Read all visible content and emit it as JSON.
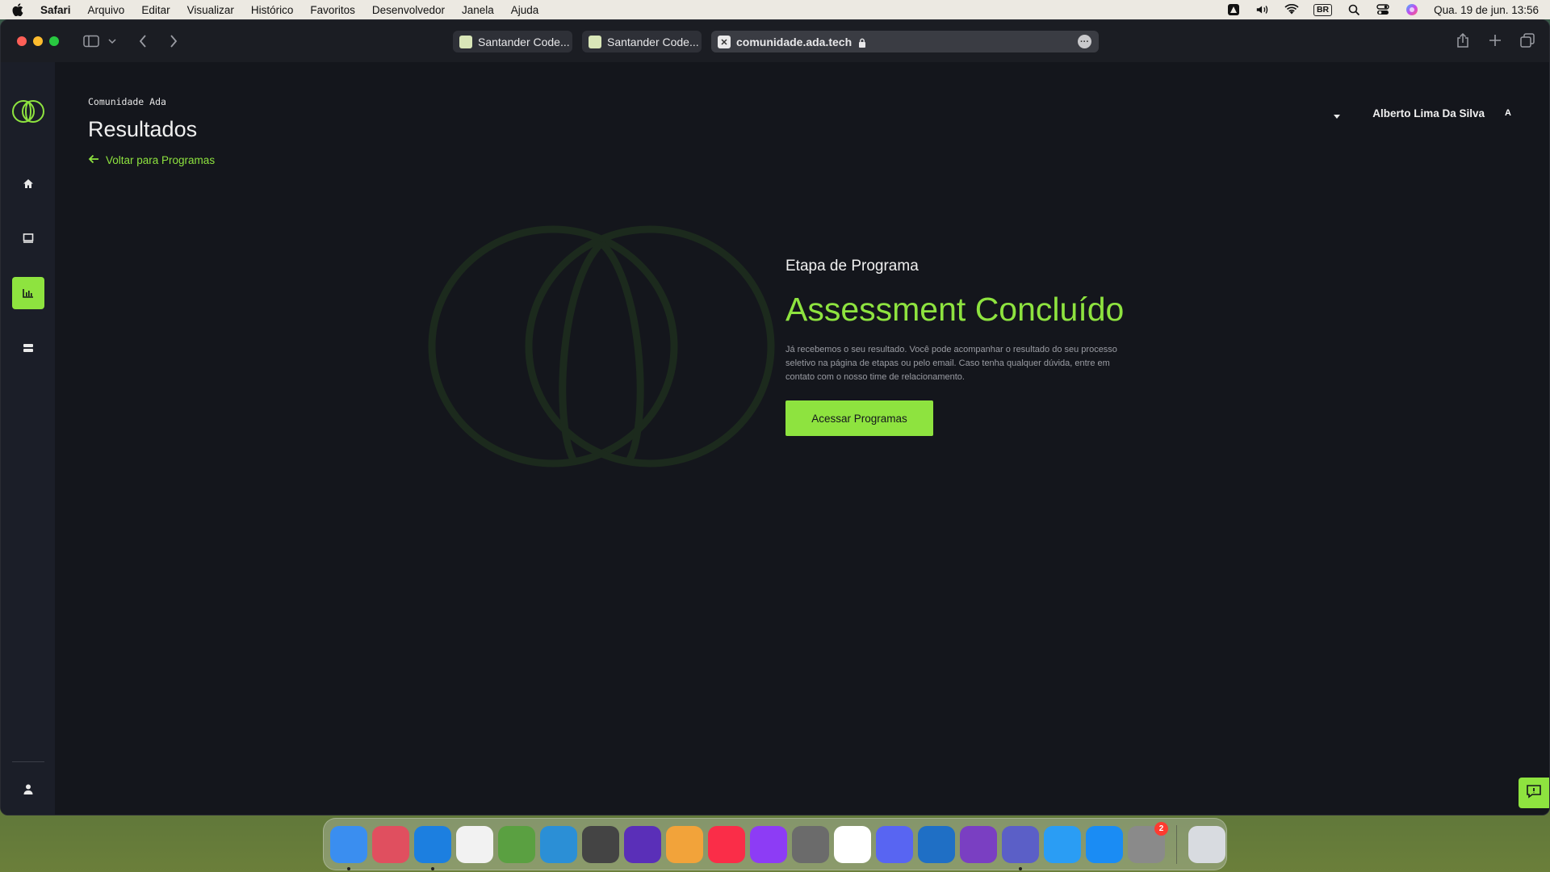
{
  "menubar": {
    "app_name": "Safari",
    "items": [
      "Arquivo",
      "Editar",
      "Visualizar",
      "Histórico",
      "Favoritos",
      "Desenvolvedor",
      "Janela",
      "Ajuda"
    ],
    "keyboard_layout": "BR",
    "clock": "Qua. 19 de jun.  13:56",
    "status_icons": [
      "accessibility-icon",
      "volume-icon",
      "wifi-icon",
      "keyboard-layout-badge",
      "spotlight-icon",
      "control-center-icon",
      "siri-icon"
    ]
  },
  "browser": {
    "tabs": [
      {
        "title": "Santander Code..."
      },
      {
        "title": "Santander Code..."
      }
    ],
    "active_tab": {
      "url": "comunidade.ada.tech"
    }
  },
  "page": {
    "breadcrumb": "Comunidade Ada",
    "title": "Resultados",
    "back_link": "Voltar para Programas",
    "user": {
      "name": "Alberto Lima Da Silva",
      "avatar_initial": "A"
    },
    "step_label": "Etapa de Programa",
    "headline": "Assessment Concluído",
    "description": "Já recebemos o seu resultado. Você pode acompanhar o resultado do seu processo seletivo na página de etapas ou pelo email. Caso tenha qualquer dúvida, entre em contato com o nosso time de relacionamento.",
    "cta_label": "Acessar Programas",
    "nav_items": [
      "home-icon",
      "book-icon",
      "chart-icon",
      "signpost-icon",
      "user-icon"
    ],
    "active_nav": "chart-icon",
    "accent_color": "#8ee33f",
    "background_color": "#14161c"
  },
  "dock": {
    "apps": [
      {
        "name": "finder-icon",
        "color": "#3a8ef0",
        "running": true
      },
      {
        "name": "launchpad-icon",
        "color": "#e04f5f"
      },
      {
        "name": "safari-icon",
        "color": "#1c7fe0",
        "running": true
      },
      {
        "name": "affinity-icon",
        "color": "#f2f2f2"
      },
      {
        "name": "rstudio-icon",
        "color": "#5aa041"
      },
      {
        "name": "gp-icon",
        "color": "#2b8fd6"
      },
      {
        "name": "app-photo-icon",
        "color": "#444444"
      },
      {
        "name": "imovie-icon",
        "color": "#5a2fb8"
      },
      {
        "name": "photos-icon",
        "color": "#f2a33a"
      },
      {
        "name": "music-icon",
        "color": "#fa2d48"
      },
      {
        "name": "affinity-heart-icon",
        "color": "#8d3cf5"
      },
      {
        "name": "gimp-icon",
        "color": "#6b6b6b"
      },
      {
        "name": "notion-icon",
        "color": "#ffffff"
      },
      {
        "name": "discord-icon",
        "color": "#5865f2"
      },
      {
        "name": "vscode-icon",
        "color": "#1f6fc5"
      },
      {
        "name": "github-desktop-icon",
        "color": "#7a3fc2"
      },
      {
        "name": "teams-icon",
        "color": "#5b5fc7",
        "running": true
      },
      {
        "name": "mail-icon",
        "color": "#2a9df4"
      },
      {
        "name": "app-store-icon",
        "color": "#1a8cf4"
      },
      {
        "name": "system-settings-icon",
        "color": "#8a8a8a",
        "badge": "2"
      },
      {
        "name": "trash-icon",
        "color": "#d8dbe0"
      }
    ]
  }
}
